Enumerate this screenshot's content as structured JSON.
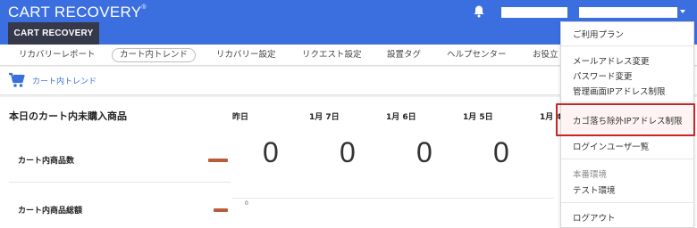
{
  "header": {
    "logo": "CART RECOVERY",
    "logo_mark": "®",
    "app_tab": "CART RECOVERY"
  },
  "nav": {
    "items": [
      {
        "label": "リカバリーレポート"
      },
      {
        "label": "カート内トレンド",
        "active": true
      },
      {
        "label": "リカバリー設定"
      },
      {
        "label": "リクエスト設定"
      },
      {
        "label": "設置タグ"
      },
      {
        "label": "ヘルプセンター"
      },
      {
        "label": "お役立"
      }
    ]
  },
  "subheader": {
    "title": "カート内トレンド"
  },
  "main": {
    "title": "本日のカート内未購入商品",
    "metrics": [
      {
        "label": "カート内商品数"
      },
      {
        "label": "カート内商品総額"
      }
    ],
    "columns": [
      "昨日",
      "1月 7日",
      "1月 6日",
      "1月 5日",
      "1月 4"
    ],
    "values": [
      "0",
      "0",
      "0",
      "0"
    ],
    "axis_zero": "0"
  },
  "dropdown": {
    "items": [
      "ご利用プラン",
      "メールアドレス変更",
      "パスワード変更",
      "管理画面IPアドレス制限",
      "カゴ落ち除外IPアドレス制限",
      "ログインユーザ一覧",
      "本番環境",
      "テスト環境",
      "ログアウト"
    ]
  },
  "colors": {
    "header_bg": "#3b6fe0",
    "app_tab_bg": "#35394a",
    "accent_link": "#3b6fe0",
    "highlight_border": "#c62626",
    "dash": "#b85c3a"
  },
  "icons": [
    "bell-icon",
    "chevron-down-icon",
    "cart-icon"
  ]
}
